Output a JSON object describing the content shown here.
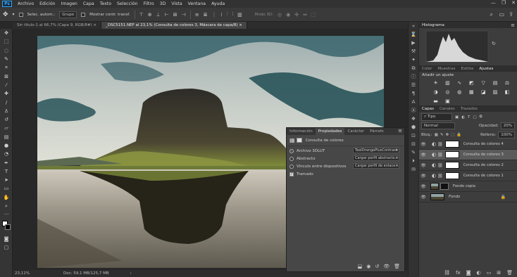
{
  "menu": {
    "items": [
      "Archivo",
      "Edición",
      "Imagen",
      "Capa",
      "Texto",
      "Selección",
      "Filtro",
      "3D",
      "Vista",
      "Ventana",
      "Ayuda"
    ],
    "logo": "Ps"
  },
  "options": {
    "auto_select_label": "Selec. autom.:",
    "auto_select_value": "Grupo",
    "show_transform": "Mostrar contr. transf.",
    "mode3d": "Modo 3D:"
  },
  "tabs": [
    {
      "label": "Sin título-1 al 66,7% (Capa 9, RGB/8#) ×",
      "active": false
    },
    {
      "label": "_DSC5151.NEF al 23,1% (Consulta de colores 3, Máscara de capa/8) ×",
      "active": true
    }
  ],
  "status": {
    "zoom": "23,11%",
    "doc": "Doc: 59,1 MB/125,7 MB"
  },
  "properties": {
    "tabs": [
      "Información",
      "Propiedades",
      "Carácter",
      "Párrafo"
    ],
    "active_tab": "Propiedades",
    "title": "Consulta de colores",
    "rows": [
      {
        "label": "Archivo 3DLUT",
        "value": "TealOrangePlusContrast...",
        "radio": true,
        "on": true
      },
      {
        "label": "Abstracto",
        "value": "Cargar perfil abstracto...",
        "radio": true,
        "on": false
      },
      {
        "label": "Vínculo entre dispositivos",
        "value": "Cargar perfil de enlace...",
        "radio": true,
        "on": false
      }
    ],
    "dither_label": "Tramado"
  },
  "histogram": {
    "title": "Histograma"
  },
  "adjust": {
    "tabs": [
      "Color",
      "Muestras",
      "Estilos",
      "Ajustes"
    ],
    "active_tab": "Ajustes",
    "add_label": "Añadir un ajuste"
  },
  "layers_panel": {
    "tabs": [
      "Capas",
      "Canales",
      "Trazados"
    ],
    "filter_kind": "Tipo",
    "blend_mode": "Normal",
    "opacity_label": "Opacidad:",
    "opacity_value": "20%",
    "lock_label": "Bloq.:",
    "fill_label": "Relleno:",
    "fill_value": "100%",
    "layers": [
      {
        "name": "Consulta de colores 4",
        "selected": false,
        "type": "adj"
      },
      {
        "name": "Consulta de colores 3",
        "selected": true,
        "type": "adj"
      },
      {
        "name": "Consulta de colores 2",
        "selected": false,
        "type": "adj"
      },
      {
        "name": "Consulta de colores 1",
        "selected": false,
        "type": "adj"
      },
      {
        "name": "Fondo copia",
        "selected": false,
        "type": "img"
      },
      {
        "name": "Fondo",
        "selected": false,
        "type": "bg"
      }
    ]
  },
  "colors": {
    "ps_blue": "#31a8ff",
    "sky": "#8fa3a4",
    "teal": "#1f4c52",
    "mountain": "#3a3a2e",
    "grass": "#7a8a38"
  }
}
